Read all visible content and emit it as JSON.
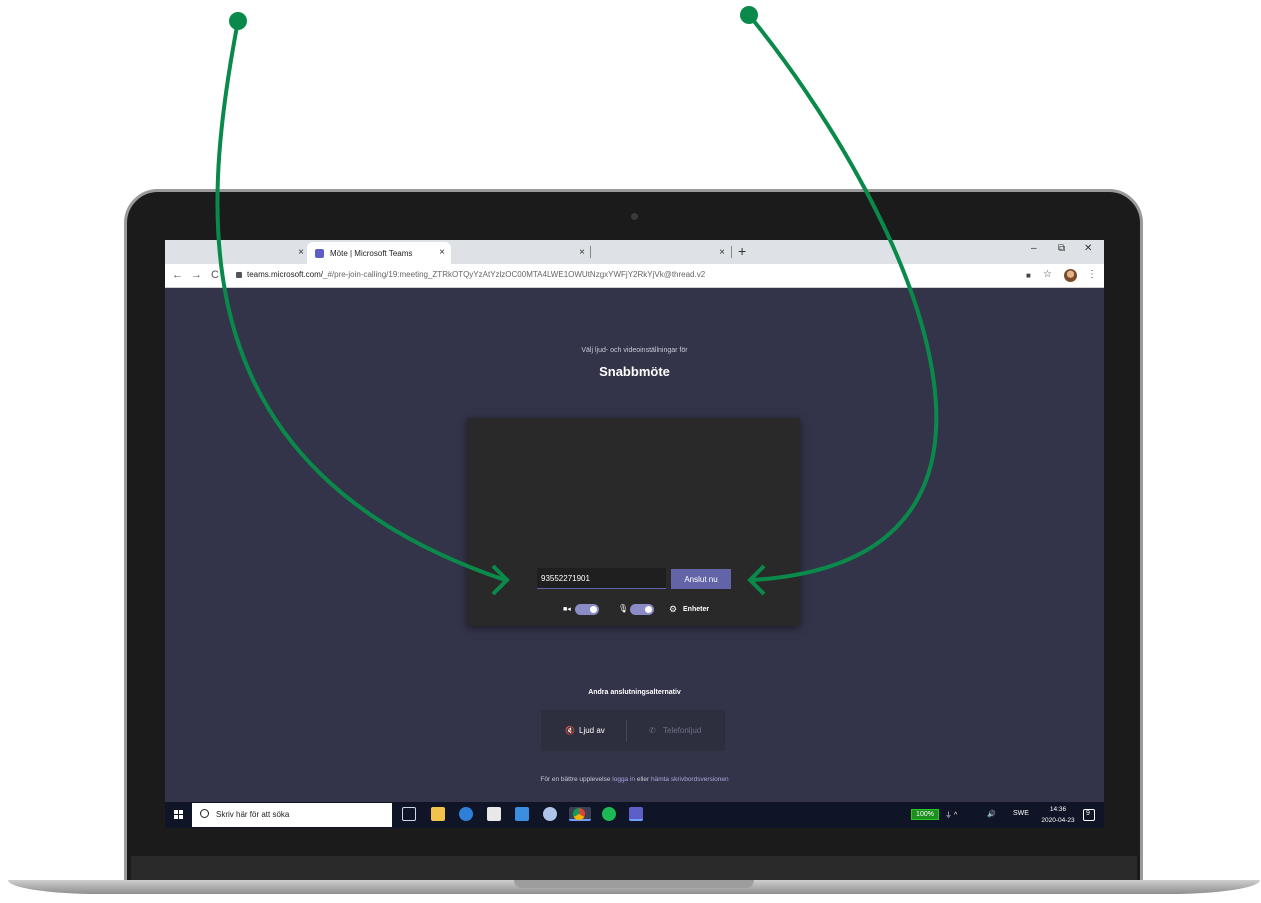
{
  "browser": {
    "tabs": [
      {
        "title": "",
        "close": "×"
      },
      {
        "title": "Möte | Microsoft Teams",
        "close": "×"
      },
      {
        "title": "",
        "close": "×"
      },
      {
        "title": "",
        "close": "×"
      }
    ],
    "new_tab": "+",
    "window_controls": {
      "minimize": "–",
      "restore": "⧉",
      "close": "✕"
    },
    "nav": {
      "back": "←",
      "forward": "→",
      "reload": "C"
    },
    "url_host": "teams.microsoft.com/",
    "url_path": "_#/pre-join-calling/19:meeting_ZTRkOTQyYzAtYzlzOC00MTA4LWE1OWUtNzgxYWFjY2RkYjVk@thread.v2",
    "toolbar": {
      "camera": "■",
      "star": "☆",
      "menu": "⋮"
    }
  },
  "teams": {
    "subtitle": "Välj ljud- och videoinställningar för",
    "title": "Snabbmöte",
    "name_value": "93552271901",
    "join_label": "Anslut nu",
    "video_icon": "■◂",
    "mic_icon": "🎙",
    "devices_icon": "⚙",
    "devices_label": "Enheter",
    "other_title": "Andra anslutningsalternativ",
    "audio_off_icon": "🔇",
    "audio_off_label": "Ljud av",
    "phone_icon": "✆",
    "phone_label": "Telefonljud",
    "footer_prefix": "För en bättre upplevelse",
    "footer_link1": "logga in",
    "footer_middle": "eller",
    "footer_link2": "hämta skrivbordsversionen"
  },
  "taskbar": {
    "search_placeholder": "Skriv här för att söka",
    "battery": "100%",
    "tray_icons": "⏚ ^",
    "tray_more": "🔊",
    "language": "SWE",
    "time": "14:36",
    "date": "2020-04-23",
    "notification_count": "9"
  },
  "colors": {
    "accent": "#6264a7",
    "teams_bg": "#33344a",
    "arrow": "#0a8a4a"
  }
}
